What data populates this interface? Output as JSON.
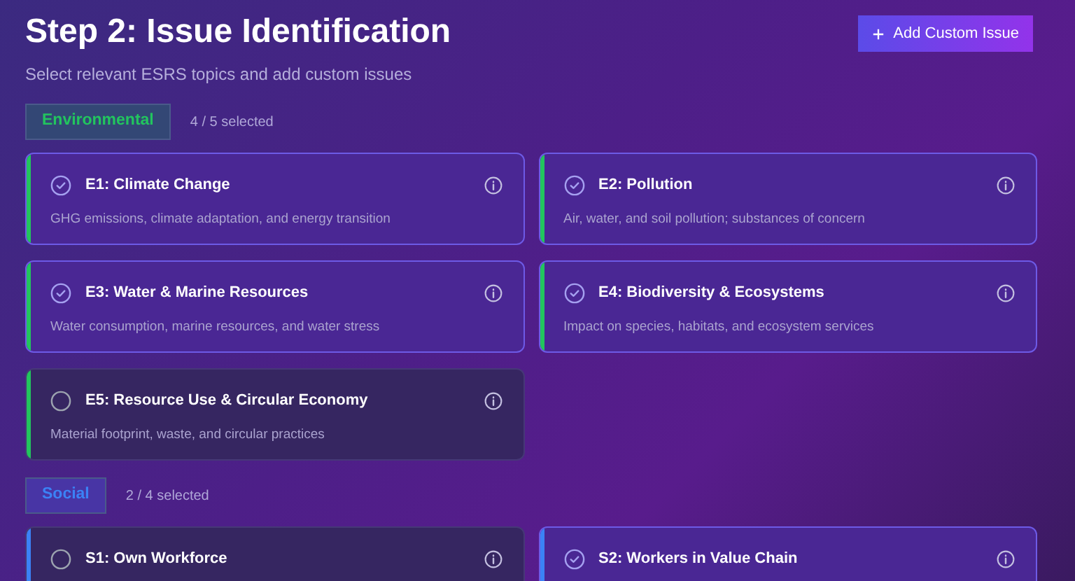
{
  "header": {
    "title": "Step 2: Issue Identification",
    "subtitle": "Select relevant ESRS topics and add custom issues"
  },
  "add_button": {
    "label": "Add Custom Issue"
  },
  "categories": [
    {
      "label": "Environmental",
      "color": "#22c55e",
      "count": "4 / 5 selected",
      "issues": [
        {
          "title": "E1: Climate Change",
          "description": "GHG emissions, climate adaptation, and energy transition",
          "selected": true
        },
        {
          "title": "E2: Pollution",
          "description": "Air, water, and soil pollution; substances of concern",
          "selected": true
        },
        {
          "title": "E3: Water & Marine Resources",
          "description": "Water consumption, marine resources, and water stress",
          "selected": true
        },
        {
          "title": "E4: Biodiversity & Ecosystems",
          "description": "Impact on species, habitats, and ecosystem services",
          "selected": true
        },
        {
          "title": "E5: Resource Use & Circular Economy",
          "description": "Material footprint, waste, and circular practices",
          "selected": false
        }
      ]
    },
    {
      "label": "Social",
      "color": "#3b82f6",
      "count": "2 / 4 selected",
      "issues": [
        {
          "title": "S1: Own Workforce",
          "selected": false
        },
        {
          "title": "S2: Workers in Value Chain",
          "selected": true
        }
      ]
    }
  ]
}
